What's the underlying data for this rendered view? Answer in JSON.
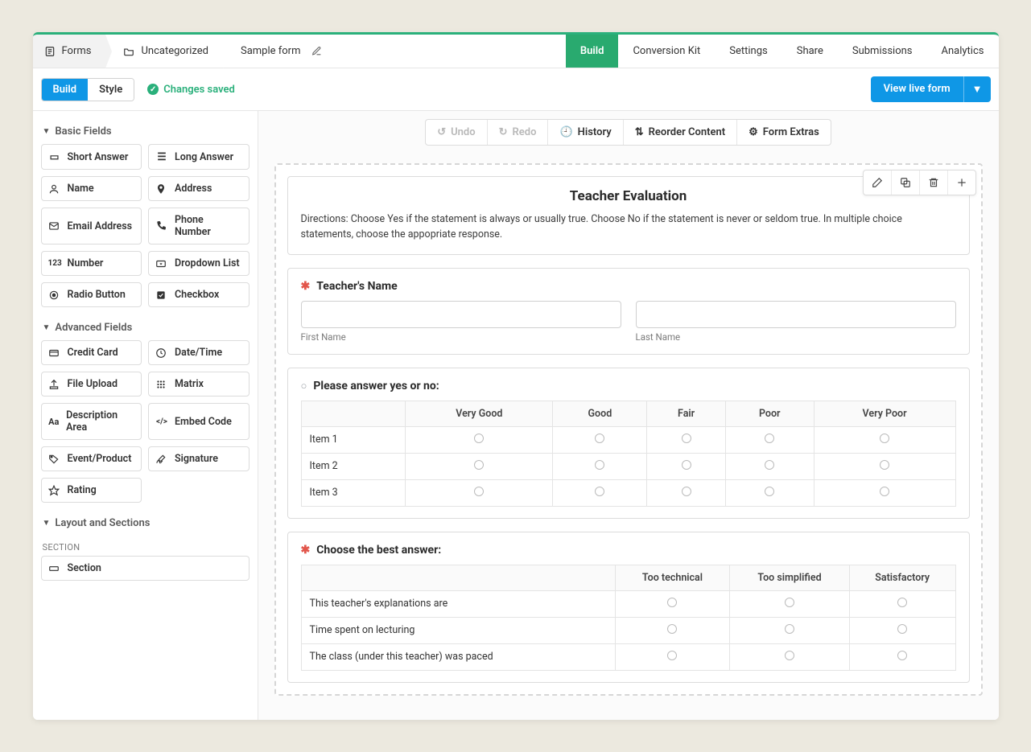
{
  "breadcrumbs": {
    "forms": "Forms",
    "folder": "Uncategorized",
    "form": "Sample form"
  },
  "topnav": {
    "build": "Build",
    "conversion": "Conversion Kit",
    "settings": "Settings",
    "share": "Share",
    "submissions": "Submissions",
    "analytics": "Analytics"
  },
  "subbar": {
    "build": "Build",
    "style": "Style",
    "saved": "Changes saved",
    "viewlive": "View live form"
  },
  "canvasToolbar": {
    "undo": "Undo",
    "redo": "Redo",
    "history": "History",
    "reorder": "Reorder Content",
    "extras": "Form Extras"
  },
  "sidebar": {
    "basic_label": "Basic Fields",
    "advanced_label": "Advanced Fields",
    "layout_label": "Layout and Sections",
    "section_group_label": "SECTION",
    "basic": {
      "short_answer": "Short Answer",
      "long_answer": "Long Answer",
      "name": "Name",
      "address": "Address",
      "email": "Email Address",
      "phone": "Phone Number",
      "number": "Number",
      "dropdown": "Dropdown List",
      "radio": "Radio Button",
      "checkbox": "Checkbox"
    },
    "advanced": {
      "credit": "Credit Card",
      "datetime": "Date/Time",
      "upload": "File Upload",
      "matrix": "Matrix",
      "description": "Description Area",
      "embed": "Embed Code",
      "event": "Event/Product",
      "signature": "Signature",
      "rating": "Rating"
    },
    "layout": {
      "section": "Section"
    }
  },
  "form": {
    "header_title": "Teacher Evaluation",
    "header_desc": "Directions: Choose Yes if the statement is always or usually true.  Choose No if the statement is never or seldom true.  In multiple choice statements, choose the appopriate response.",
    "q1": {
      "label": "Teacher's Name",
      "first": "First Name",
      "last": "Last Name"
    },
    "q2": {
      "label": "Please answer yes or no:",
      "cols": [
        "Very Good",
        "Good",
        "Fair",
        "Poor",
        "Very Poor"
      ],
      "rows": [
        "Item 1",
        "Item 2",
        "Item 3"
      ]
    },
    "q3": {
      "label": "Choose the best answer:",
      "cols": [
        "Too technical",
        "Too simplified",
        "Satisfactory"
      ],
      "rows": [
        "This teacher's explanations are",
        "Time spent on lecturing",
        "The class (under this teacher) was paced"
      ]
    }
  }
}
